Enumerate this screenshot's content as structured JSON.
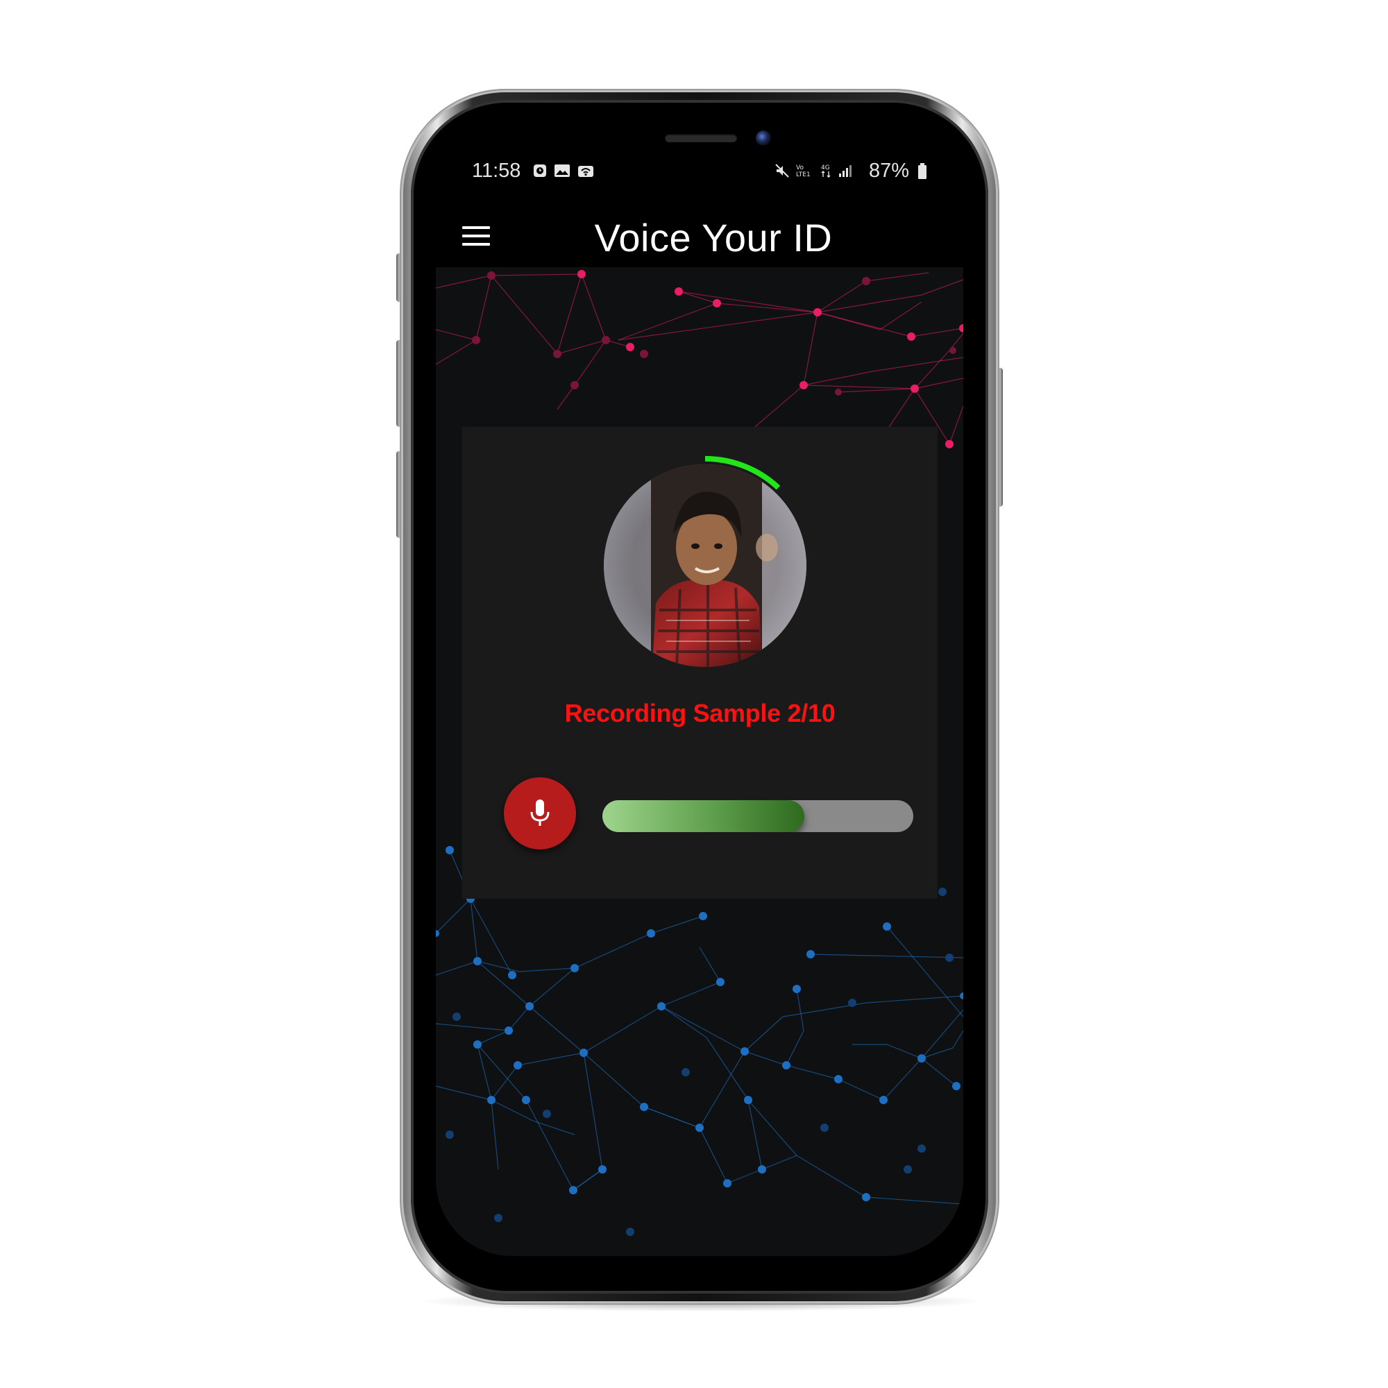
{
  "status_bar": {
    "time": "11:58",
    "left_icons": [
      "alarm-icon",
      "gallery-icon",
      "hotspot-icon"
    ],
    "right_icons": [
      "mute-icon",
      "volte-icon",
      "4g-icon",
      "signal-icon"
    ],
    "battery_text": "87%",
    "battery_level": 0.87
  },
  "app_bar": {
    "menu_icon": "hamburger-menu-icon",
    "title": "Voice Your ID"
  },
  "card": {
    "avatar_icon": "profile-photo",
    "ring_progress": 0.12,
    "ring_color": "#22e51a",
    "sample_label": "Recording Sample 2/10",
    "sample_label_color": "#ff1111",
    "mic_button_icon": "microphone-icon",
    "mic_button_color": "#b71c1c",
    "audio_level": 0.65
  },
  "theme": {
    "background": "#0e1012",
    "card_background": "#1a1a1a",
    "network_top_color": "#e91e63",
    "network_bottom_color": "#1e6fc2"
  }
}
